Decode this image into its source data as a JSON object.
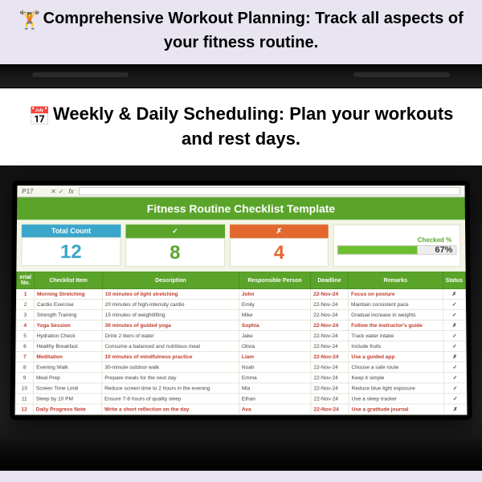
{
  "banners": {
    "b1": "Comprehensive Workout Planning: Track all aspects of your fitness routine.",
    "b2": "Weekly & Daily Scheduling: Plan your workouts and rest days."
  },
  "formula_bar": {
    "cell_ref": "P17",
    "fx": "fx"
  },
  "sheet": {
    "title": "Fitness Routine Checklist Template",
    "stats": {
      "total_label": "Total Count",
      "total_value": "12",
      "done_label": "✓",
      "done_value": "8",
      "not_label": "✗",
      "not_value": "4",
      "pct_label": "Checked %",
      "pct_value": "67%",
      "pct_fill_width": "67%"
    },
    "columns": {
      "no": "erial No.",
      "item": "Checklist Item",
      "desc": "Description",
      "person": "Responsible Person",
      "deadline": "Deadline",
      "remarks": "Remarks",
      "status": "Status"
    },
    "rows": [
      {
        "no": "1",
        "item": "Morning Stretching",
        "desc": "10 minutes of light stretching",
        "person": "John",
        "deadline": "22-Nov-24",
        "remarks": "Focus on posture",
        "status": "✗",
        "red": true
      },
      {
        "no": "2",
        "item": "Cardio Exercise",
        "desc": "20 minutes of high-intensity cardio",
        "person": "Emily",
        "deadline": "22-Nov-24",
        "remarks": "Maintain consistent pace",
        "status": "✓",
        "red": false
      },
      {
        "no": "3",
        "item": "Strength Training",
        "desc": "15 minutes of weightlifting",
        "person": "Mike",
        "deadline": "22-Nov-24",
        "remarks": "Gradual increase in weights",
        "status": "✓",
        "red": false
      },
      {
        "no": "4",
        "item": "Yoga Session",
        "desc": "30 minutes of guided yoga",
        "person": "Sophia",
        "deadline": "22-Nov-24",
        "remarks": "Follow the instructor's guide",
        "status": "✗",
        "red": true
      },
      {
        "no": "5",
        "item": "Hydration Check",
        "desc": "Drink 2 liters of water",
        "person": "Jake",
        "deadline": "22-Nov-24",
        "remarks": "Track water intake",
        "status": "✓",
        "red": false
      },
      {
        "no": "6",
        "item": "Healthy Breakfast",
        "desc": "Consume a balanced and nutritious meal",
        "person": "Olivia",
        "deadline": "22-Nov-24",
        "remarks": "Include fruits",
        "status": "✓",
        "red": false
      },
      {
        "no": "7",
        "item": "Meditation",
        "desc": "10 minutes of mindfulness practice",
        "person": "Liam",
        "deadline": "22-Nov-24",
        "remarks": "Use a guided app",
        "status": "✗",
        "red": true
      },
      {
        "no": "8",
        "item": "Evening Walk",
        "desc": "30-minute outdoor walk",
        "person": "Noah",
        "deadline": "22-Nov-24",
        "remarks": "Choose a safe route",
        "status": "✓",
        "red": false
      },
      {
        "no": "9",
        "item": "Meal Prep",
        "desc": "Prepare meals for the next day",
        "person": "Emma",
        "deadline": "22-Nov-24",
        "remarks": "Keep it simple",
        "status": "✓",
        "red": false
      },
      {
        "no": "10",
        "item": "Screen Time Limit",
        "desc": "Reduce screen time to 2 hours in the evening",
        "person": "Mia",
        "deadline": "22-Nov-24",
        "remarks": "Reduce blue light exposure",
        "status": "✓",
        "red": false
      },
      {
        "no": "11",
        "item": "Sleep by 10 PM",
        "desc": "Ensure 7-8 hours of quality sleep",
        "person": "Ethan",
        "deadline": "22-Nov-24",
        "remarks": "Use a sleep tracker",
        "status": "✓",
        "red": false
      },
      {
        "no": "12",
        "item": "Daily Progress Note",
        "desc": "Write a short reflection on the day",
        "person": "Ava",
        "deadline": "22-Nov-24",
        "remarks": "Use a gratitude journal",
        "status": "✗",
        "red": true
      }
    ]
  }
}
